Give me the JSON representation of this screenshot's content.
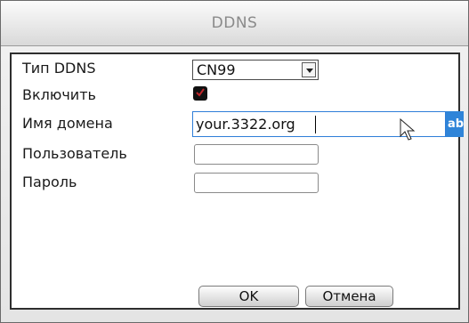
{
  "window": {
    "title": "DDNS"
  },
  "form": {
    "ddns_type": {
      "label": "Тип DDNS",
      "value": "CN99",
      "icon": "chevron-down-icon"
    },
    "enable": {
      "label": "Включить",
      "checked": true
    },
    "domain": {
      "label": "Имя домена",
      "value": "your.3322.org",
      "tag": "ab"
    },
    "user": {
      "label": "Пользователь",
      "value": ""
    },
    "password": {
      "label": "Пароль",
      "value": ""
    }
  },
  "buttons": {
    "ok": "OK",
    "cancel": "Отмена"
  },
  "colors": {
    "accent": "#2f84d8",
    "checkbox": "#111111",
    "checkmark": "#c0262b"
  }
}
